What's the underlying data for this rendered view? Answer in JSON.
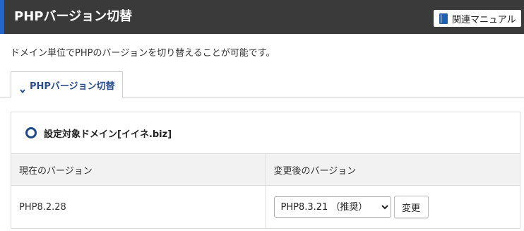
{
  "header": {
    "title": "PHPバージョン切替",
    "manual_button": {
      "label": "関連マニュアル",
      "icon": "book-icon"
    }
  },
  "description": "ドメイン単位でPHPのバージョンを切り替えることが可能です。",
  "tabs": [
    {
      "label": "PHPバージョン切替",
      "icon": "chevron-down-icon",
      "active": true
    }
  ],
  "section": {
    "title": "設定対象ドメイン[イイネ.biz]",
    "icon": "radio-icon"
  },
  "table": {
    "headers": [
      "現在のバージョン",
      "変更後のバージョン"
    ],
    "current_version": "PHP8.2.28",
    "selected_version": "PHP8.3.21 （推奨）",
    "change_button_label": "変更"
  },
  "colors": {
    "header_bg": "#3a3a3a",
    "header_accent": "#2266cc",
    "tab_text": "#2b4f8c",
    "radio": "#1f4a8a",
    "table_header_bg": "#f2f2f2"
  }
}
